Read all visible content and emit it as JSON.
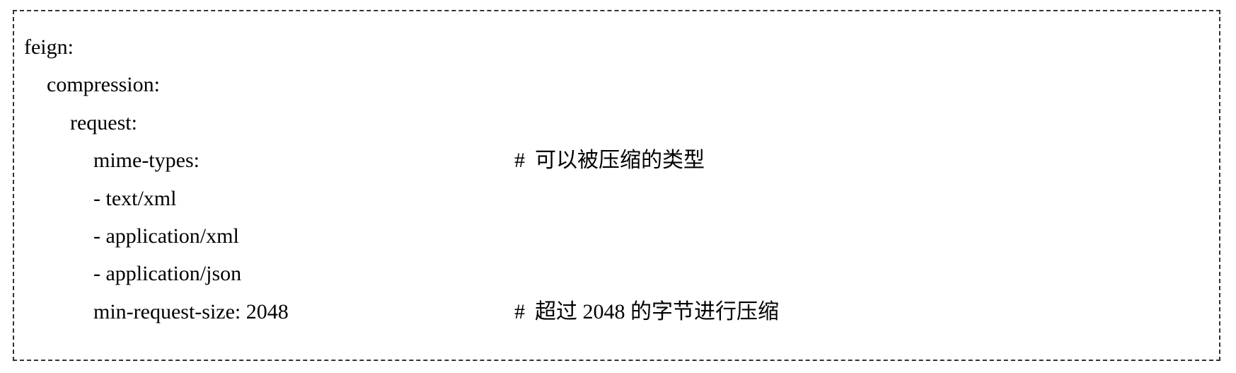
{
  "document": {
    "lines": [
      {
        "text": "feign:",
        "comment": ""
      },
      {
        "text": "compression:",
        "comment": ""
      },
      {
        "text": "request:",
        "comment": ""
      },
      {
        "text": "mime-types:",
        "comment": "可以被压缩的类型"
      },
      {
        "text": "- text/xml",
        "comment": ""
      },
      {
        "text": "- application/xml",
        "comment": ""
      },
      {
        "text": "- application/json",
        "comment": ""
      },
      {
        "text": "min-request-size: 2048",
        "comment": "超过 2048 的字节进行压缩"
      }
    ],
    "comment_marker": "#"
  }
}
